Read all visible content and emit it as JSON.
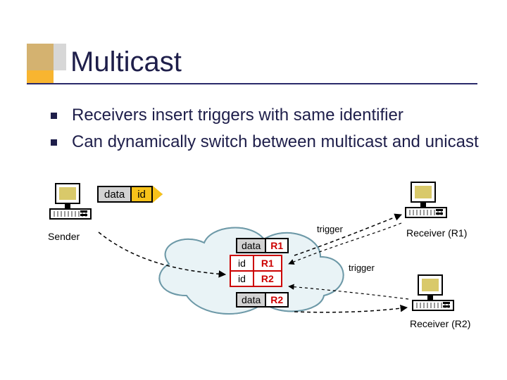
{
  "title": "Multicast",
  "bullets": [
    "Receivers insert triggers with same identifier",
    "Can dynamically switch between multicast and unicast"
  ],
  "sender_label": "Sender",
  "receiver1_label": "Receiver (R1)",
  "receiver2_label": "Receiver (R2)",
  "trigger_label_1": "trigger",
  "trigger_label_2": "trigger",
  "packet": {
    "data": "data",
    "id": "id"
  },
  "trigger_table": {
    "rows": [
      {
        "id": "id",
        "r": "R1"
      },
      {
        "id": "id",
        "r": "R2"
      }
    ]
  },
  "data_tag_top": {
    "data": "data",
    "r": "R1"
  },
  "data_tag_bottom": {
    "data": "data",
    "r": "R2"
  }
}
